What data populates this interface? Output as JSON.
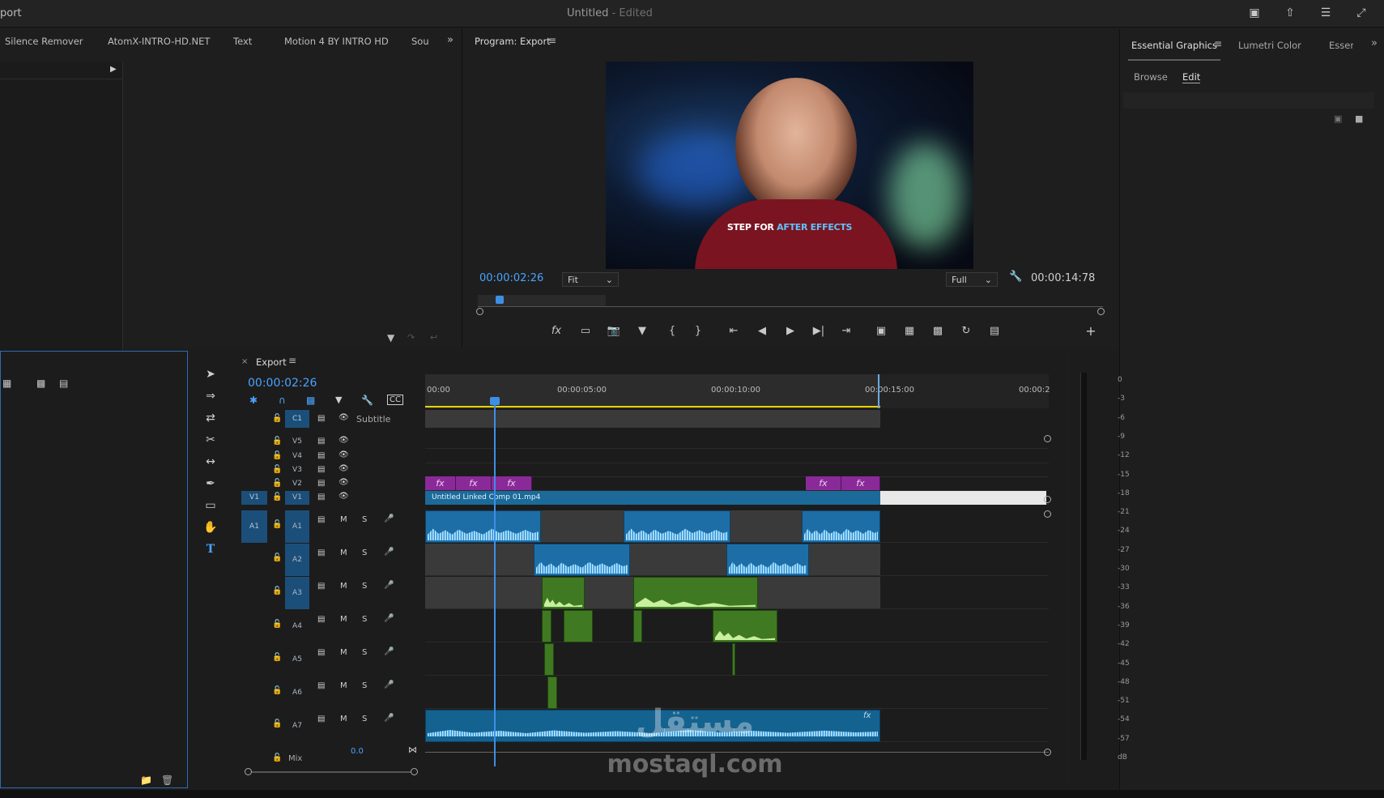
{
  "window": {
    "app_label": "port",
    "title": "Untitled",
    "title_suffix": "- Edited"
  },
  "left_panel": {
    "tabs": [
      "Silence Remover",
      "AtomX-INTRO-HD.NET",
      "Text",
      "Motion 4 BY INTRO HD",
      "Soui"
    ]
  },
  "program_monitor": {
    "title": "Program: Export",
    "timecode": "00:00:02:26",
    "duration": "00:00:14:78",
    "fit_label": "Fit",
    "quality_label": "Full",
    "video_caption_white": "STEP FOR",
    "video_caption_blue": "AFTER EFFECTS",
    "playhead_fraction": 0.028
  },
  "right_panel": {
    "tabs": [
      "Essential Graphics",
      "Lumetri Color",
      "Essen"
    ],
    "subtabs": [
      "Browse",
      "Edit"
    ]
  },
  "timeline": {
    "sequence_name": "Export",
    "timecode": "00:00:02:26",
    "ruler": [
      "00:00",
      "00:00:05:00",
      "00:00:10:00",
      "00:00:15:00",
      "00:00:2"
    ],
    "subtitle_track": {
      "id": "C1",
      "label": "Subtitle"
    },
    "video_tracks": [
      "V5",
      "V4",
      "V3",
      "V2",
      "V1"
    ],
    "source_v": "V1",
    "source_a": "A1",
    "audio_tracks": [
      "A1",
      "A2",
      "A3",
      "A4",
      "A5",
      "A6",
      "A7"
    ],
    "track_buttons": {
      "mute": "M",
      "solo": "S"
    },
    "mix_label": "Mix",
    "mix_value": "0.0",
    "v1_clip_name": "Untitled Linked Comp 01.mp4",
    "fx_label": "fx"
  },
  "audio_meter": {
    "scale": [
      "0",
      "-3",
      "-6",
      "-9",
      "-12",
      "-15",
      "-18",
      "-21",
      "-24",
      "-27",
      "-30",
      "-33",
      "-36",
      "-39",
      "-42",
      "-45",
      "-48",
      "-51",
      "-54",
      "-57",
      "dB"
    ]
  },
  "watermark": {
    "arabic": "مستقل",
    "latin": "mostaql.com"
  },
  "colors": {
    "accent_blue": "#4aa3ff",
    "video_clip": "#8a2a98",
    "audio_clip": "#1d6ea6",
    "music_clip": "#3f7a22",
    "work_area": "#e6d400"
  },
  "icons": [
    "filter-icon",
    "insert-icon",
    "overwrite-icon",
    "play-icon",
    "step-back-icon",
    "step-forward-icon",
    "mark-in-icon",
    "mark-out-icon",
    "go-to-in-icon",
    "go-to-out-icon",
    "lift-icon",
    "extract-icon",
    "export-frame-icon",
    "marker-icon",
    "wrench-icon",
    "add-icon",
    "selection-tool-icon",
    "track-select-icon",
    "ripple-edit-icon",
    "razor-icon",
    "slip-icon",
    "pen-icon",
    "rectangle-icon",
    "hand-icon",
    "type-tool-icon",
    "snap-icon",
    "linked-icon",
    "captions-icon",
    "lock-icon",
    "eye-icon",
    "mic-icon",
    "folder-icon",
    "trash-icon"
  ]
}
